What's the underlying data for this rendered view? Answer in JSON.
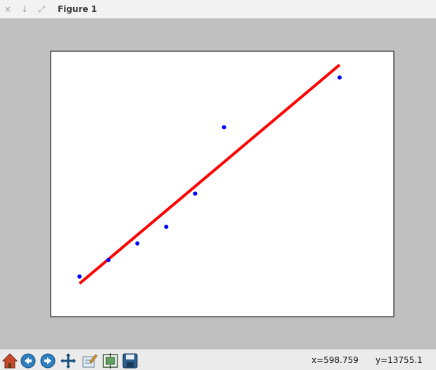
{
  "window": {
    "title": "Figure 1",
    "controls": [
      "×",
      "↓",
      "⤢"
    ]
  },
  "colors": {
    "figure_bg": "#c0c0c0",
    "axes_bg": "#ffffff",
    "points": "#0000ff",
    "fit_line": "#ff0000"
  },
  "chart_data": {
    "type": "scatter",
    "grid": false,
    "legend": "none",
    "xlabel": "",
    "ylabel": "",
    "xlim": [
      0,
      1
    ],
    "ylim": [
      0,
      1
    ],
    "series": [
      {
        "kind": "scatter",
        "color": "#0000ff",
        "x": [
          0.0842,
          0.1684,
          0.2526,
          0.3368,
          0.4211,
          0.5053,
          0.8421
        ],
        "y": [
          0.151,
          0.2135,
          0.276,
          0.3385,
          0.4635,
          0.7135,
          0.901
        ]
      },
      {
        "kind": "line",
        "color": "#ff0000",
        "x": [
          0.0842,
          0.8421
        ],
        "y": [
          0.1245,
          0.9486
        ]
      }
    ]
  },
  "toolbar": {
    "tools": [
      "home-icon",
      "back-icon",
      "forward-icon",
      "pan-icon",
      "edit-axes-icon",
      "configure-subplots-icon",
      "save-icon"
    ],
    "x_readout": "x=598.759",
    "y_readout": "y=13755.1"
  }
}
